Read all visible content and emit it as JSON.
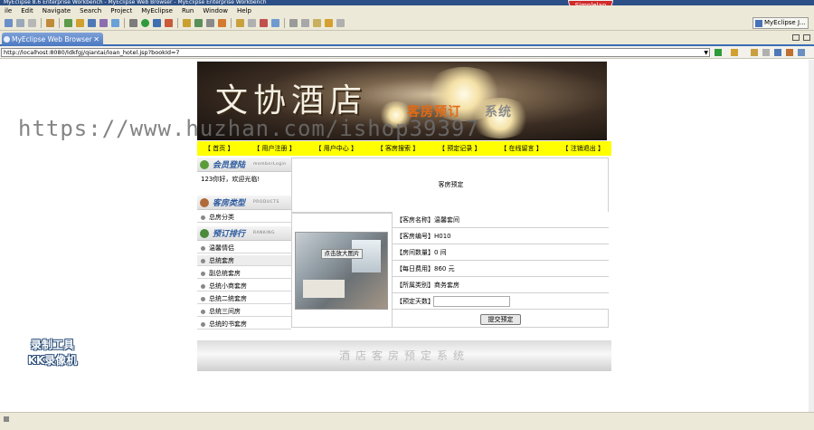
{
  "window": {
    "title": "MyEclipse 8.6 Enterprise Workbench - MyEclipse Web Browser - MyEclipse Enterprise Workbench",
    "badge": "Simplelap"
  },
  "menu": [
    "ile",
    "Edit",
    "Navigate",
    "Search",
    "Project",
    "MyEclipse",
    "Run",
    "Window",
    "Help"
  ],
  "perspective": "MyEclipse J...",
  "tab": {
    "label": "MyEclipse Web Browser",
    "close": "✕"
  },
  "address": {
    "url": "http://localhost:8080/ldkfgj/qiantai/loan_hotel.jsp?bookId=7"
  },
  "page": {
    "banner_title": "文协酒店",
    "banner_sub_orange": "客房预订",
    "banner_sub_gray": "系统",
    "watermark": "https://www.huzhan.com/ishop39397",
    "nav": [
      "【 首页 】",
      "【 用户注册 】",
      "【 用户中心 】",
      "【 客房搜索 】",
      "【 预定记录 】",
      "【 在线留言 】",
      "【 注销退出 】"
    ],
    "member": {
      "title": "会员登陆",
      "en": "memberLogin",
      "greeting": "123你好，欢迎光临!"
    },
    "room_types": {
      "title": "客房类型",
      "en": "PRODUCTS",
      "items": [
        "总房分类"
      ]
    },
    "booking_rank": {
      "title": "预订排行",
      "en": "RANKING",
      "items": [
        "温馨情侣",
        "总统套房",
        "副总统套房",
        "总统小商套房",
        "总统二统套房",
        "总统三间房",
        "总统的书套房"
      ]
    },
    "main_title": "客房预定",
    "photo_caption": "点击放大图片",
    "details": [
      "【客房名称】温馨套间",
      "【客房编号】H010",
      "【房间数量】0 间",
      "【每日费用】860 元",
      "【所属类别】商务套房",
      "【预定天数】"
    ],
    "submit": "提交预定",
    "footer": "酒店客房预定系统"
  },
  "recorder": {
    "line1": "录制工具",
    "line2": "KK录像机"
  }
}
